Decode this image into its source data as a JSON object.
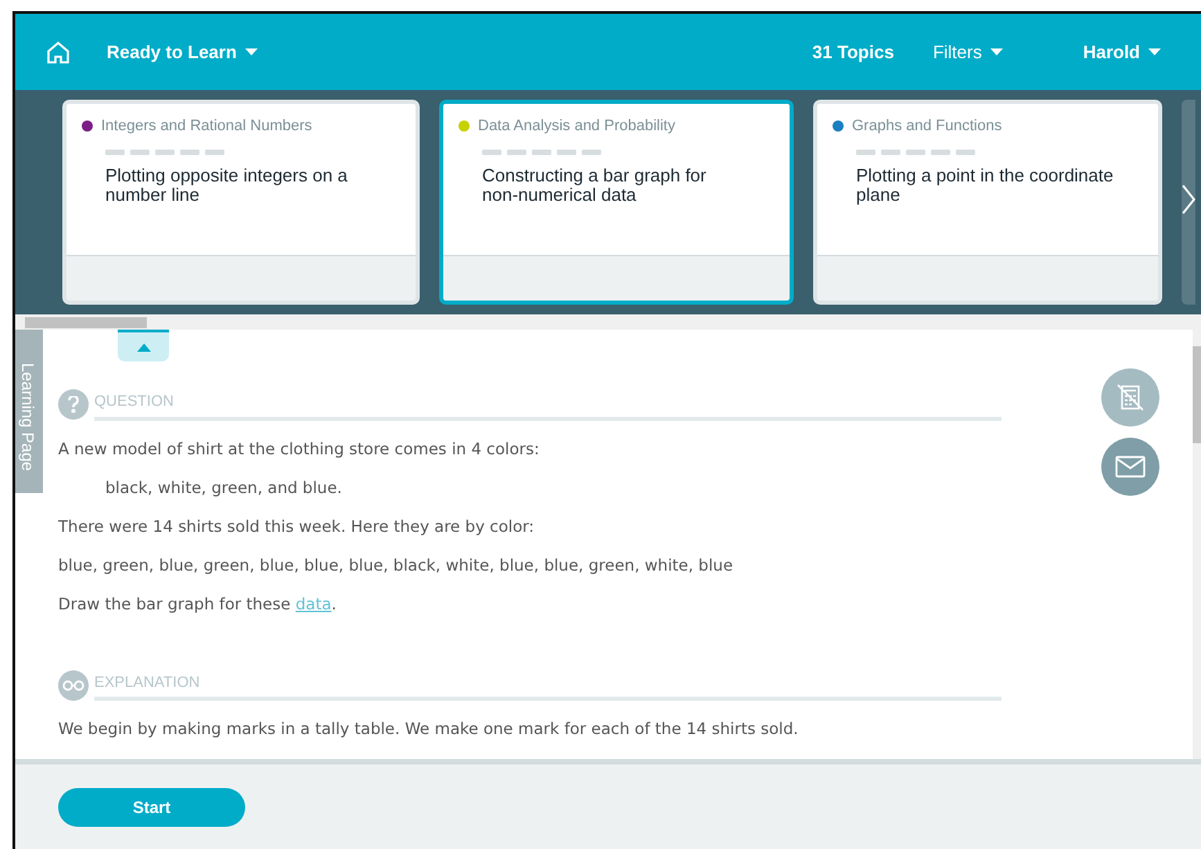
{
  "header": {
    "menu": "Ready to Learn",
    "topics": "31 Topics",
    "filters": "Filters",
    "user": "Harold"
  },
  "cards": [
    {
      "topic": "Integers and Rational Numbers",
      "color": "#7b1f87",
      "title": "Plotting opposite integers on a number line",
      "selected": false
    },
    {
      "topic": "Data Analysis and Probability",
      "color": "#c6d200",
      "title": "Constructing a bar graph for non-numerical data",
      "selected": true
    },
    {
      "topic": "Graphs and Functions",
      "color": "#1a7fc1",
      "title": "Plotting a point in the coordinate plane",
      "selected": false
    }
  ],
  "side_tab": "Learning Page",
  "question": {
    "heading": "QUESTION",
    "paragraphs": [
      {
        "text": "A new model of shirt at the clothing store comes in 4 colors:",
        "indent": false
      },
      {
        "text": "black, white, green, and blue.",
        "indent": true
      },
      {
        "text": "There were 14 shirts sold this week. Here they are by color:",
        "indent": false
      },
      {
        "text": "blue, green, blue, green, blue, blue, blue, black, white, blue, blue, green, white, blue",
        "indent": false
      }
    ],
    "link_sentence": {
      "before": "Draw the bar graph for these ",
      "link": "data",
      "after": "."
    }
  },
  "explanation": {
    "heading": "EXPLANATION",
    "paragraphs": [
      {
        "text": "We begin by making marks in a tally table. We make one mark for each of the 14 shirts sold.",
        "indent": false
      }
    ]
  },
  "start_button": "Start"
}
